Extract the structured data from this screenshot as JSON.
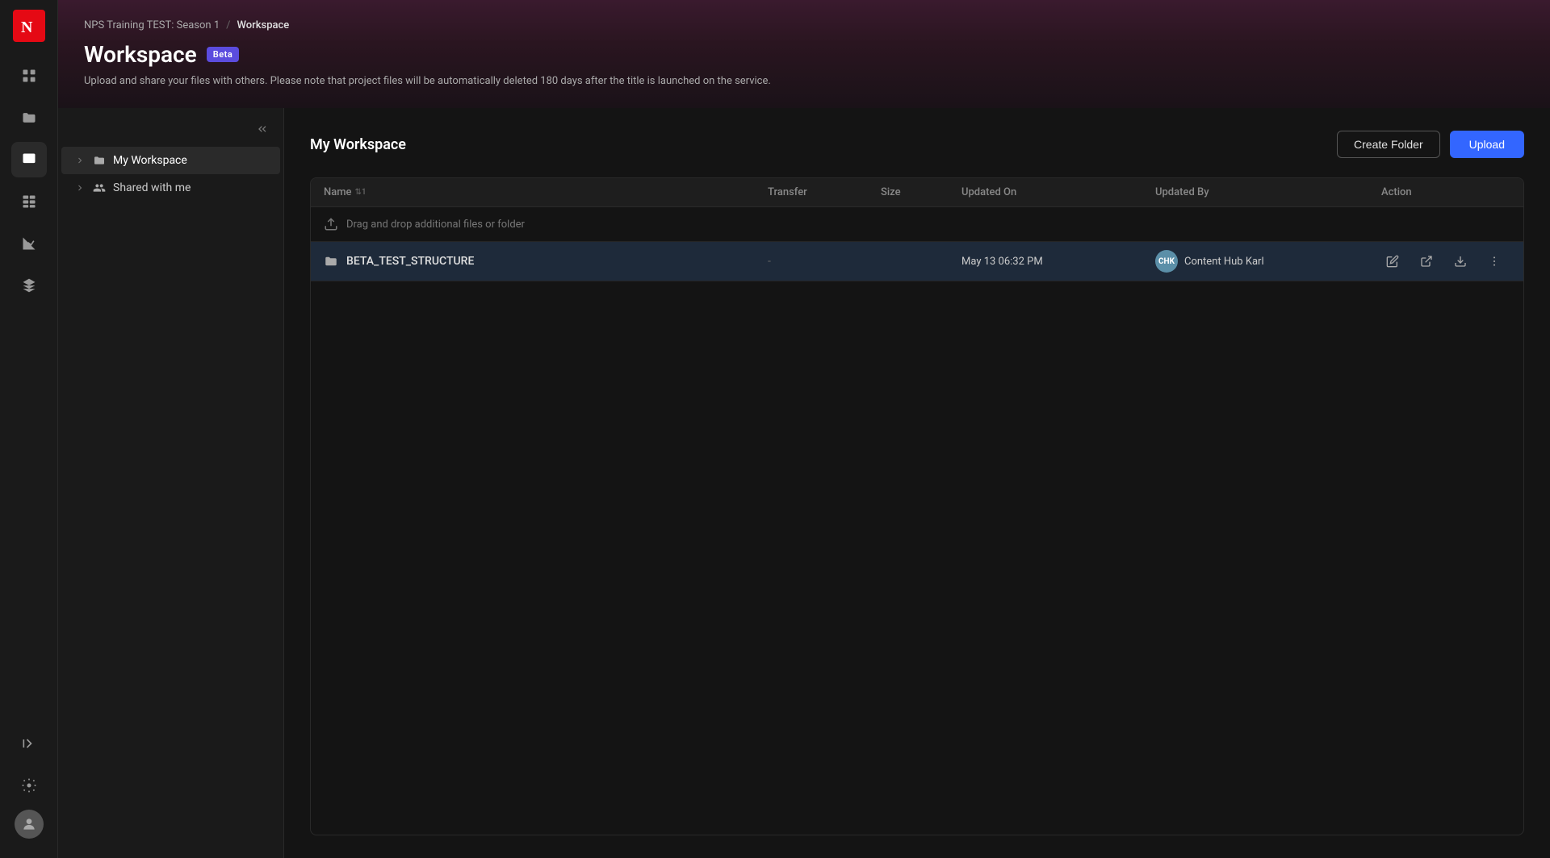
{
  "nav": {
    "logo_label": "N",
    "items": [
      {
        "id": "home",
        "icon": "home",
        "active": false
      },
      {
        "id": "folder",
        "icon": "folder",
        "active": false
      },
      {
        "id": "workspace",
        "icon": "workspace",
        "active": true
      },
      {
        "id": "grid",
        "icon": "grid",
        "active": false
      },
      {
        "id": "chart",
        "icon": "chart",
        "active": false
      },
      {
        "id": "layers",
        "icon": "layers",
        "active": false
      }
    ],
    "bottom": [
      {
        "id": "collapse",
        "icon": "collapse"
      },
      {
        "id": "settings",
        "icon": "settings"
      }
    ]
  },
  "breadcrumb": {
    "parent": "NPS Training TEST: Season 1",
    "separator": "/",
    "current": "Workspace"
  },
  "header": {
    "title": "Workspace",
    "badge": "Beta",
    "subtitle": "Upload and share your files with others. Please note that project files will be automatically deleted 180 days after the title is launched on the service."
  },
  "sidebar": {
    "my_workspace_label": "My Workspace",
    "shared_with_me_label": "Shared with me"
  },
  "workspace": {
    "title": "My Workspace",
    "create_folder_label": "Create Folder",
    "upload_label": "Upload",
    "table": {
      "columns": {
        "name": "Name",
        "transfer": "Transfer",
        "size": "Size",
        "updated_on": "Updated On",
        "updated_by": "Updated By",
        "action": "Action"
      },
      "drag_drop_label": "Drag and drop additional files or folder",
      "rows": [
        {
          "name": "BETA_TEST_STRUCTURE",
          "type": "folder",
          "transfer": "-",
          "size": "",
          "updated_on": "May 13 06:32 PM",
          "updated_by": "Content Hub Karl",
          "updated_by_initials": "CHK"
        }
      ]
    }
  }
}
